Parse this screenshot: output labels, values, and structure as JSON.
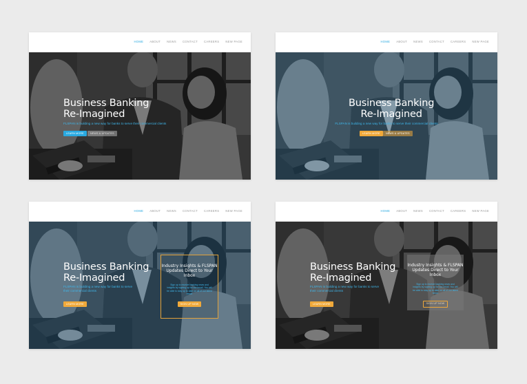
{
  "nav": [
    "HOME",
    "ABOUT",
    "NEWS",
    "CONTACT",
    "CAREERS",
    "NEW PAGE"
  ],
  "hero": {
    "title_line1": "Business Banking",
    "title_line2": "Re-Imagined",
    "subtitle": "FLSPAN is building a new way for banks to serve their commercial clients",
    "primary_button": "LEARN MORE",
    "secondary_button": "NEWS & UPDATES"
  },
  "signup": {
    "heading": "Industry Insights & FLSPAN Updates Direct to Your Inbox",
    "text": "Sign up to receive banking news and insights by signing up for our email. You will be able to stay up to date on all of our latest news!",
    "button": "SIGN UP NOW"
  },
  "colors": {
    "accent_blue": "#2aa9e0",
    "accent_orange": "#f0a93a",
    "page_bg": "#ebebeb"
  }
}
